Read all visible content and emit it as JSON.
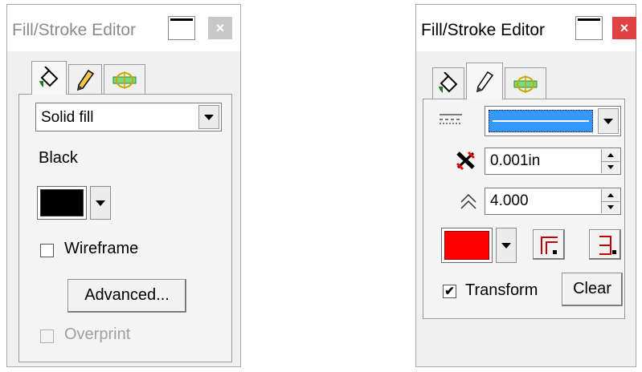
{
  "left_panel": {
    "title": "Fill/Stroke Editor",
    "close_glyph": "×",
    "tabs": [
      {
        "icon": "paint-bucket-icon",
        "active": true
      },
      {
        "icon": "pencil-icon",
        "active": false
      },
      {
        "icon": "transform-icon",
        "active": false
      }
    ],
    "fill_type": "Solid fill",
    "color_name": "Black",
    "swatch_color": "#000000",
    "wireframe_label": "Wireframe",
    "wireframe_checked": false,
    "advanced_label": "Advanced...",
    "overprint_label": "Overprint",
    "overprint_checked": false,
    "overprint_disabled": true
  },
  "right_panel": {
    "title": "Fill/Stroke Editor",
    "close_glyph": "×",
    "close_color": "#e04343",
    "tabs": [
      {
        "icon": "paint-bucket-icon",
        "active": false
      },
      {
        "icon": "pencil-icon",
        "active": true
      },
      {
        "icon": "transform-icon",
        "active": false
      }
    ],
    "line_style_icon": "dash-pattern-icon",
    "line_color": "#3399ff",
    "width_value": "0.001in",
    "miter_value": "4.000",
    "swatch_color": "#ff0000",
    "transform_label": "Transform",
    "transform_checked": true,
    "check_glyph": "✔",
    "clear_label": "Clear"
  }
}
